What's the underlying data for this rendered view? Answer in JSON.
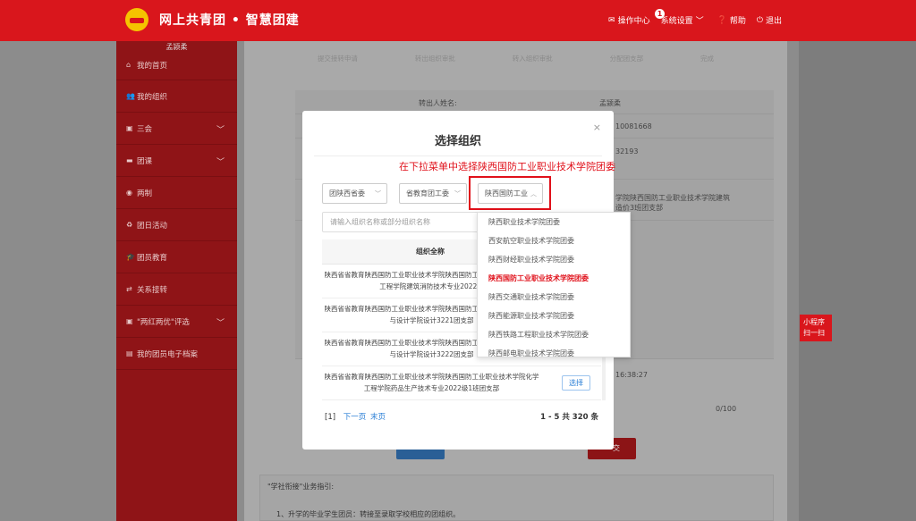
{
  "header": {
    "title": "网上共青团 • 智慧团建",
    "nav": {
      "ops_center": "操作中心",
      "ops_badge": "1",
      "settings": "系统设置",
      "help": "帮助",
      "logout": "退出"
    }
  },
  "sidebar": {
    "user": "孟颍柔",
    "items": [
      {
        "label": "我的首页"
      },
      {
        "label": "我的组织"
      },
      {
        "label": "三会"
      },
      {
        "label": "团课"
      },
      {
        "label": "两制"
      },
      {
        "label": "团日活动"
      },
      {
        "label": "团员教育"
      },
      {
        "label": "关系接转"
      },
      {
        "label": "\"两红两优\"评选"
      },
      {
        "label": "我的团员电子档案"
      }
    ]
  },
  "steps": [
    "提交接转申请",
    "转出组织审批",
    "转入组织审批",
    "分配团支部",
    "完成"
  ],
  "background": {
    "transfer_name_label": "转出人姓名:",
    "transfer_name_value": "孟颍柔",
    "id_fragment": "10081668",
    "id_fragment2": "32193",
    "org_fragment": "学院陕西国防工业职业技术学院建筑",
    "org_fragment2": "造价3班团支部",
    "time_fragment": "16:38:27",
    "counter": "0/100",
    "submit_fragment": "交",
    "guide_title": "\"学社衔接\"业务指引:",
    "guide_text": "1、升学的毕业学生团员：转接至录取学校相应的团组织。",
    "miniprogram": "小程序扫一扫"
  },
  "modal": {
    "title": "选择组织",
    "instruction": "在下拉菜单中选择陕西国防工业职业技术学院团委",
    "selects": [
      "团陕西省委",
      "省教育团工委",
      "陕西国防工业"
    ],
    "search_placeholder": "请输入组织名称或部分组织名称",
    "table_header": "组织全称",
    "rows": [
      "陕西省省教育陕西国防工业职业技术学院陕西国防工业职业技术学院化学工程学院建筑消防技术专业2022级",
      "陕西省省教育陕西国防工业职业技术学院陕西国防工业职业技术学院艺术与设计学院设计3221团支部",
      "陕西省省教育陕西国防工业职业技术学院陕西国防工业职业技术学院艺术与设计学院设计3222团支部",
      "陕西省省教育陕西国防工业职业技术学院陕西国防工业职业技术学院化学工程学院药品生产技术专业2022级1班团支部"
    ],
    "choose_label": "选择",
    "pager": {
      "current": "[1]",
      "next": "下一页",
      "last": "末页"
    },
    "total": "1 - 5  共 320 条"
  },
  "dropdown": {
    "items": [
      "陕西职业技术学院团委",
      "西安航空职业技术学院团委",
      "陕西财经职业技术学院团委",
      "陕西国防工业职业技术学院团委",
      "陕西交通职业技术学院团委",
      "陕西能源职业技术学院团委",
      "陕西铁路工程职业技术学院团委",
      "陕西邮电职业技术学院团委"
    ],
    "active_index": 3,
    "highlight_color": "#e0101a"
  },
  "colors": {
    "brand": "#d9161c",
    "accent_blue": "#2b7fd6"
  }
}
